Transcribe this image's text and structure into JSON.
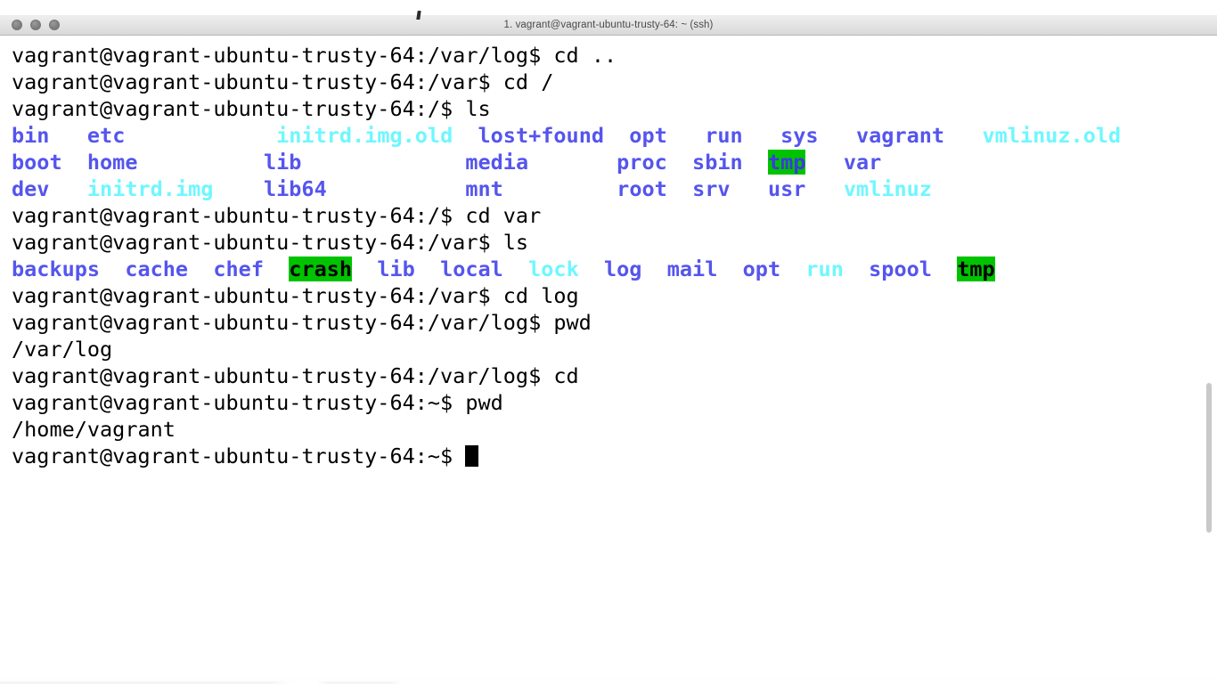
{
  "window": {
    "title": "1. vagrant@vagrant-ubuntu-trusty-64: ~ (ssh)",
    "buttons": [
      "close",
      "minimize",
      "zoom"
    ]
  },
  "colors": {
    "background": "#ffffff",
    "foreground": "#000000",
    "directory": "#5555ee",
    "symlink": "#6ff7ff",
    "sticky_bg": "#00c300",
    "titlebar_bg": "#e4e4e4",
    "scrollbar": "#c9c9c9"
  },
  "terminal": {
    "prompt_host": "vagrant@vagrant-ubuntu-trusty-64",
    "lines": [
      {
        "id": "l1",
        "segments": [
          {
            "text": "vagrant@vagrant-ubuntu-trusty-64:/var/log$ cd ..",
            "style": "default"
          }
        ]
      },
      {
        "id": "l2",
        "segments": [
          {
            "text": "vagrant@vagrant-ubuntu-trusty-64:/var$ cd /",
            "style": "default"
          }
        ]
      },
      {
        "id": "l3",
        "segments": [
          {
            "text": "vagrant@vagrant-ubuntu-trusty-64:/$ ls",
            "style": "default"
          }
        ]
      },
      {
        "id": "l4",
        "segments": [
          {
            "text": "bin",
            "style": "dir"
          },
          {
            "text": "   ",
            "style": "default"
          },
          {
            "text": "etc",
            "style": "dir"
          },
          {
            "text": "            ",
            "style": "default"
          },
          {
            "text": "initrd.img.old",
            "style": "link"
          },
          {
            "text": "  ",
            "style": "default"
          },
          {
            "text": "lost+found",
            "style": "dir"
          },
          {
            "text": "  ",
            "style": "default"
          },
          {
            "text": "opt",
            "style": "dir"
          },
          {
            "text": "   ",
            "style": "default"
          },
          {
            "text": "run",
            "style": "dir"
          },
          {
            "text": "   ",
            "style": "default"
          },
          {
            "text": "sys",
            "style": "dir"
          },
          {
            "text": "   ",
            "style": "default"
          },
          {
            "text": "vagrant",
            "style": "dir"
          },
          {
            "text": "   ",
            "style": "default"
          },
          {
            "text": "vmlinuz.old",
            "style": "link"
          }
        ]
      },
      {
        "id": "l5",
        "segments": [
          {
            "text": "boot",
            "style": "dir"
          },
          {
            "text": "  ",
            "style": "default"
          },
          {
            "text": "home",
            "style": "dir"
          },
          {
            "text": "          ",
            "style": "default"
          },
          {
            "text": "lib",
            "style": "dir"
          },
          {
            "text": "             ",
            "style": "default"
          },
          {
            "text": "media",
            "style": "dir"
          },
          {
            "text": "       ",
            "style": "default"
          },
          {
            "text": "proc",
            "style": "dir"
          },
          {
            "text": "  ",
            "style": "default"
          },
          {
            "text": "sbin",
            "style": "dir"
          },
          {
            "text": "  ",
            "style": "default"
          },
          {
            "text": "tmp",
            "style": "stickydir"
          },
          {
            "text": "   ",
            "style": "default"
          },
          {
            "text": "var",
            "style": "dir"
          }
        ]
      },
      {
        "id": "l6",
        "segments": [
          {
            "text": "dev",
            "style": "dir"
          },
          {
            "text": "   ",
            "style": "default"
          },
          {
            "text": "initrd.img",
            "style": "link"
          },
          {
            "text": "    ",
            "style": "default"
          },
          {
            "text": "lib64",
            "style": "dir"
          },
          {
            "text": "           ",
            "style": "default"
          },
          {
            "text": "mnt",
            "style": "dir"
          },
          {
            "text": "         ",
            "style": "default"
          },
          {
            "text": "root",
            "style": "dir"
          },
          {
            "text": "  ",
            "style": "default"
          },
          {
            "text": "srv",
            "style": "dir"
          },
          {
            "text": "   ",
            "style": "default"
          },
          {
            "text": "usr",
            "style": "dir"
          },
          {
            "text": "   ",
            "style": "default"
          },
          {
            "text": "vmlinuz",
            "style": "link"
          }
        ]
      },
      {
        "id": "l7",
        "segments": [
          {
            "text": "vagrant@vagrant-ubuntu-trusty-64:/$ cd var",
            "style": "default"
          }
        ]
      },
      {
        "id": "l8",
        "segments": [
          {
            "text": "vagrant@vagrant-ubuntu-trusty-64:/var$ ls",
            "style": "default"
          }
        ]
      },
      {
        "id": "l9",
        "segments": [
          {
            "text": "backups",
            "style": "dir"
          },
          {
            "text": "  ",
            "style": "default"
          },
          {
            "text": "cache",
            "style": "dir"
          },
          {
            "text": "  ",
            "style": "default"
          },
          {
            "text": "chef",
            "style": "dir"
          },
          {
            "text": "  ",
            "style": "default"
          },
          {
            "text": "crash",
            "style": "sticky"
          },
          {
            "text": "  ",
            "style": "default"
          },
          {
            "text": "lib",
            "style": "dir"
          },
          {
            "text": "  ",
            "style": "default"
          },
          {
            "text": "local",
            "style": "dir"
          },
          {
            "text": "  ",
            "style": "default"
          },
          {
            "text": "lock",
            "style": "link"
          },
          {
            "text": "  ",
            "style": "default"
          },
          {
            "text": "log",
            "style": "dir"
          },
          {
            "text": "  ",
            "style": "default"
          },
          {
            "text": "mail",
            "style": "dir"
          },
          {
            "text": "  ",
            "style": "default"
          },
          {
            "text": "opt",
            "style": "dir"
          },
          {
            "text": "  ",
            "style": "default"
          },
          {
            "text": "run",
            "style": "link"
          },
          {
            "text": "  ",
            "style": "default"
          },
          {
            "text": "spool",
            "style": "dir"
          },
          {
            "text": "  ",
            "style": "default"
          },
          {
            "text": "tmp",
            "style": "sticky"
          }
        ]
      },
      {
        "id": "l10",
        "segments": [
          {
            "text": "vagrant@vagrant-ubuntu-trusty-64:/var$ cd log",
            "style": "default"
          }
        ]
      },
      {
        "id": "l11",
        "segments": [
          {
            "text": "vagrant@vagrant-ubuntu-trusty-64:/var/log$ pwd",
            "style": "default"
          }
        ]
      },
      {
        "id": "l12",
        "segments": [
          {
            "text": "/var/log",
            "style": "default"
          }
        ]
      },
      {
        "id": "l13",
        "segments": [
          {
            "text": "vagrant@vagrant-ubuntu-trusty-64:/var/log$ cd",
            "style": "default"
          }
        ]
      },
      {
        "id": "l14",
        "segments": [
          {
            "text": "vagrant@vagrant-ubuntu-trusty-64:~$ pwd",
            "style": "default"
          }
        ]
      },
      {
        "id": "l15",
        "segments": [
          {
            "text": "/home/vagrant",
            "style": "default"
          }
        ]
      },
      {
        "id": "l16",
        "segments": [
          {
            "text": "vagrant@vagrant-ubuntu-trusty-64:~$ ",
            "style": "default"
          }
        ],
        "cursor": true
      }
    ]
  }
}
